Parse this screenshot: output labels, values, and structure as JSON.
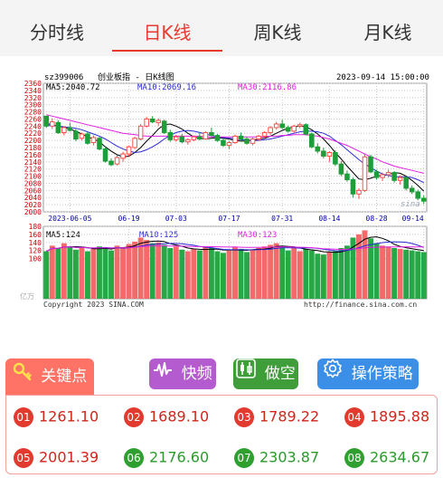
{
  "tabs": [
    {
      "label": "分时线",
      "active": false
    },
    {
      "label": "日K线",
      "active": true
    },
    {
      "label": "周K线",
      "active": false
    },
    {
      "label": "月K线",
      "active": false
    }
  ],
  "chart_header": {
    "code": "sz399006",
    "title": "创业板指 - 日K线图",
    "datetime": "2023-09-14 15:00:00",
    "ma5": "MA5:2040.72",
    "ma10": "MA10:2069.16",
    "ma30": "MA30:2116.86",
    "vol_ma5": "MA5:124",
    "vol_ma10": "MA10:125",
    "vol_ma30": "MA30:123",
    "copyright": "Copyright 2023 SINA.COM",
    "source_url": "http://finance.sina.com.cn",
    "vol_unit": "亿万",
    "watermark": "sina"
  },
  "colors": {
    "up": "#ff4d4d",
    "down": "#1e9e3a",
    "ma5": "#000000",
    "ma10": "#2b2bd6",
    "ma30": "#e020e0",
    "accent": "#e8392f"
  },
  "chart_data": {
    "type": "candlestick",
    "price_ylim": [
      2000,
      2360
    ],
    "price_ticks": [
      "2360",
      "2340",
      "2320",
      "2300",
      "2280",
      "2260",
      "2240",
      "2220",
      "2200",
      "2180",
      "2160",
      "2140",
      "2120",
      "2100",
      "2080",
      "2060",
      "2040",
      "2020",
      "2000"
    ],
    "volume_ylim": [
      0,
      180
    ],
    "volume_ticks": [
      "180",
      "160",
      "140",
      "120",
      "100"
    ],
    "date_labels": [
      "2023-06-05",
      "06-19",
      "07-03",
      "07-17",
      "07-31",
      "08-14",
      "08-28",
      "09-14"
    ],
    "ohlc": [
      [
        2268,
        2262,
        2235,
        2240
      ],
      [
        2240,
        2262,
        2232,
        2252
      ],
      [
        2250,
        2256,
        2218,
        2222
      ],
      [
        2222,
        2240,
        2214,
        2236
      ],
      [
        2236,
        2250,
        2225,
        2228
      ],
      [
        2226,
        2232,
        2198,
        2204
      ],
      [
        2206,
        2222,
        2200,
        2218
      ],
      [
        2218,
        2224,
        2188,
        2192
      ],
      [
        2194,
        2214,
        2186,
        2208
      ],
      [
        2206,
        2210,
        2172,
        2176
      ],
      [
        2176,
        2182,
        2138,
        2142
      ],
      [
        2142,
        2150,
        2128,
        2132
      ],
      [
        2134,
        2158,
        2130,
        2152
      ],
      [
        2150,
        2168,
        2140,
        2162
      ],
      [
        2162,
        2186,
        2156,
        2182
      ],
      [
        2180,
        2210,
        2176,
        2206
      ],
      [
        2204,
        2246,
        2200,
        2240
      ],
      [
        2240,
        2266,
        2236,
        2260
      ],
      [
        2260,
        2268,
        2248,
        2252
      ],
      [
        2250,
        2262,
        2240,
        2256
      ],
      [
        2254,
        2258,
        2218,
        2222
      ],
      [
        2222,
        2230,
        2196,
        2202
      ],
      [
        2202,
        2216,
        2196,
        2210
      ],
      [
        2210,
        2218,
        2192,
        2196
      ],
      [
        2196,
        2206,
        2188,
        2202
      ],
      [
        2202,
        2214,
        2198,
        2210
      ],
      [
        2210,
        2222,
        2200,
        2204
      ],
      [
        2204,
        2226,
        2202,
        2222
      ],
      [
        2222,
        2236,
        2210,
        2214
      ],
      [
        2214,
        2218,
        2196,
        2200
      ],
      [
        2200,
        2206,
        2182,
        2186
      ],
      [
        2186,
        2198,
        2176,
        2194
      ],
      [
        2194,
        2216,
        2190,
        2212
      ],
      [
        2212,
        2222,
        2200,
        2204
      ],
      [
        2204,
        2210,
        2188,
        2192
      ],
      [
        2192,
        2208,
        2186,
        2204
      ],
      [
        2204,
        2216,
        2198,
        2212
      ],
      [
        2212,
        2226,
        2206,
        2222
      ],
      [
        2222,
        2240,
        2216,
        2236
      ],
      [
        2236,
        2252,
        2230,
        2246
      ],
      [
        2246,
        2258,
        2232,
        2236
      ],
      [
        2236,
        2242,
        2222,
        2226
      ],
      [
        2226,
        2244,
        2222,
        2240
      ],
      [
        2240,
        2250,
        2234,
        2244
      ],
      [
        2244,
        2248,
        2214,
        2218
      ],
      [
        2218,
        2222,
        2178,
        2182
      ],
      [
        2182,
        2192,
        2164,
        2170
      ],
      [
        2170,
        2180,
        2150,
        2156
      ],
      [
        2156,
        2170,
        2140,
        2166
      ],
      [
        2166,
        2172,
        2128,
        2134
      ],
      [
        2134,
        2142,
        2100,
        2106
      ],
      [
        2106,
        2116,
        2084,
        2090
      ],
      [
        2090,
        2096,
        2040,
        2050
      ],
      [
        2050,
        2066,
        2036,
        2060
      ],
      [
        2060,
        2162,
        2056,
        2154
      ],
      [
        2154,
        2160,
        2108,
        2112
      ],
      [
        2112,
        2118,
        2090,
        2096
      ],
      [
        2096,
        2110,
        2086,
        2104
      ],
      [
        2104,
        2118,
        2096,
        2110
      ],
      [
        2110,
        2114,
        2082,
        2088
      ],
      [
        2088,
        2102,
        2076,
        2096
      ],
      [
        2096,
        2100,
        2060,
        2066
      ],
      [
        2066,
        2074,
        2050,
        2056
      ],
      [
        2056,
        2062,
        2032,
        2038
      ],
      [
        2038,
        2046,
        2022,
        2030
      ]
    ],
    "volume": [
      [
        118,
        0
      ],
      [
        132,
        1
      ],
      [
        126,
        0
      ],
      [
        138,
        1
      ],
      [
        130,
        0
      ],
      [
        122,
        0
      ],
      [
        128,
        1
      ],
      [
        118,
        0
      ],
      [
        124,
        1
      ],
      [
        130,
        0
      ],
      [
        126,
        0
      ],
      [
        120,
        0
      ],
      [
        132,
        1
      ],
      [
        128,
        1
      ],
      [
        136,
        1
      ],
      [
        142,
        1
      ],
      [
        152,
        1
      ],
      [
        146,
        1
      ],
      [
        138,
        0
      ],
      [
        140,
        1
      ],
      [
        134,
        0
      ],
      [
        126,
        0
      ],
      [
        130,
        1
      ],
      [
        122,
        0
      ],
      [
        118,
        1
      ],
      [
        124,
        1
      ],
      [
        120,
        0
      ],
      [
        128,
        1
      ],
      [
        126,
        0
      ],
      [
        118,
        0
      ],
      [
        114,
        0
      ],
      [
        120,
        1
      ],
      [
        128,
        1
      ],
      [
        124,
        0
      ],
      [
        116,
        0
      ],
      [
        122,
        1
      ],
      [
        126,
        1
      ],
      [
        130,
        1
      ],
      [
        134,
        1
      ],
      [
        138,
        1
      ],
      [
        128,
        0
      ],
      [
        120,
        0
      ],
      [
        126,
        1
      ],
      [
        118,
        1
      ],
      [
        124,
        0
      ],
      [
        120,
        0
      ],
      [
        112,
        0
      ],
      [
        110,
        0
      ],
      [
        116,
        1
      ],
      [
        118,
        0
      ],
      [
        126,
        0
      ],
      [
        132,
        0
      ],
      [
        152,
        0
      ],
      [
        160,
        1
      ],
      [
        170,
        1
      ],
      [
        150,
        0
      ],
      [
        138,
        0
      ],
      [
        132,
        1
      ],
      [
        130,
        1
      ],
      [
        126,
        0
      ],
      [
        124,
        1
      ],
      [
        122,
        0
      ],
      [
        120,
        0
      ],
      [
        118,
        0
      ],
      [
        116,
        0
      ]
    ],
    "ma_lines": {
      "MA5": [
        2248,
        2244,
        2240,
        2236,
        2232,
        2226,
        2218,
        2210,
        2204,
        2196,
        2182,
        2170,
        2160,
        2154,
        2156,
        2166,
        2180,
        2198,
        2214,
        2232,
        2244,
        2246,
        2240,
        2232,
        2220,
        2210,
        2206,
        2204,
        2206,
        2208,
        2206,
        2204,
        2200,
        2198,
        2198,
        2200,
        2204,
        2206,
        2212,
        2220,
        2228,
        2234,
        2238,
        2240,
        2238,
        2230,
        2218,
        2204,
        2186,
        2166,
        2148,
        2128,
        2110,
        2092,
        2090,
        2094,
        2100,
        2102,
        2104,
        2110,
        2108,
        2100,
        2088,
        2074,
        2058
      ],
      "MA10": [
        2244,
        2242,
        2240,
        2238,
        2236,
        2234,
        2230,
        2224,
        2218,
        2212,
        2204,
        2194,
        2184,
        2176,
        2170,
        2166,
        2168,
        2174,
        2182,
        2192,
        2204,
        2214,
        2222,
        2226,
        2228,
        2226,
        2222,
        2218,
        2214,
        2210,
        2208,
        2206,
        2204,
        2202,
        2200,
        2200,
        2200,
        2202,
        2204,
        2208,
        2212,
        2216,
        2220,
        2224,
        2226,
        2226,
        2224,
        2220,
        2212,
        2200,
        2188,
        2174,
        2160,
        2146,
        2134,
        2124,
        2114,
        2106,
        2102,
        2098,
        2098,
        2098,
        2096,
        2090,
        2082
      ],
      "MA30": [
        2272,
        2268,
        2264,
        2260,
        2256,
        2252,
        2248,
        2244,
        2240,
        2236,
        2232,
        2228,
        2224,
        2220,
        2218,
        2216,
        2214,
        2212,
        2212,
        2212,
        2212,
        2212,
        2212,
        2212,
        2212,
        2212,
        2212,
        2210,
        2210,
        2210,
        2210,
        2210,
        2210,
        2210,
        2210,
        2210,
        2210,
        2210,
        2212,
        2212,
        2214,
        2214,
        2216,
        2216,
        2216,
        2214,
        2212,
        2208,
        2204,
        2198,
        2192,
        2186,
        2178,
        2170,
        2162,
        2154,
        2148,
        2140,
        2134,
        2128,
        2124,
        2120,
        2116,
        2112,
        2108
      ]
    }
  },
  "buttons": {
    "key_points": "关键点",
    "fast_freq": "快频",
    "short": "做空",
    "strategy": "操作策略"
  },
  "key_levels": [
    {
      "num": "01",
      "value": "1261.10",
      "color": "red"
    },
    {
      "num": "02",
      "value": "1689.10",
      "color": "red"
    },
    {
      "num": "03",
      "value": "1789.22",
      "color": "red"
    },
    {
      "num": "04",
      "value": "1895.88",
      "color": "red"
    },
    {
      "num": "05",
      "value": "2001.39",
      "color": "red"
    },
    {
      "num": "06",
      "value": "2176.60",
      "color": "green"
    },
    {
      "num": "07",
      "value": "2303.87",
      "color": "green"
    },
    {
      "num": "08",
      "value": "2634.67",
      "color": "green"
    }
  ]
}
